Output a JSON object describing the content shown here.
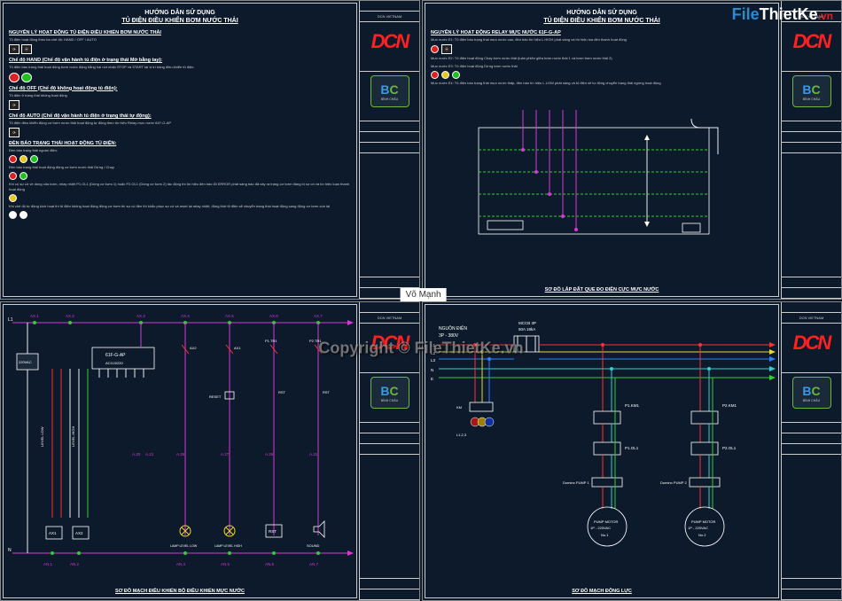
{
  "watermarks": {
    "site_logo_file": "File",
    "site_logo_tk": "ThietKe",
    "site_logo_vn": ".vn",
    "center": "Copyright © FileThietKe.vn",
    "author": "Võ Mạnh"
  },
  "titleblock": {
    "company": "DCN VIETNAM",
    "logo": "DCN",
    "consultant_mark_b": "B",
    "consultant_mark_c": "C",
    "consultant": "BÌNH CHÂU"
  },
  "sheet1": {
    "t1": "HƯỚNG DẪN SỬ DỤNG",
    "t2": "TỦ ĐIỆN ĐIỀU KHIỂN BƠM NƯỚC THẢI",
    "h1": "NGUYÊN LÝ HOẠT ĐỘNG TỦ ĐIỆN ĐIỀU KHIỂN BƠM NƯỚC THẢI",
    "d1": "Tủ điện hoạt động theo ba chế độ: HAND / OFF / AUTO",
    "h2": "Chế độ HAND (Chế độ vận hành tủ điện ở trạng thái Mở bằng tay):",
    "d2": "Tủ điện báo trạng thái hoạt động bơm nước động bằng hai nút nhấn STOP và START tại vị trí bảng điều khiển tủ điện.",
    "h3": "Chế độ OFF (Chế độ không hoạt động tủ điện):",
    "d3": "Tủ điện ở trạng thái không hoạt động",
    "h4": "Chế độ AUTO (Chế độ vận hành tủ điện ở trạng thái tự động):",
    "d4": "Tủ điện điều khiển động cơ bơm nước thải hoạt động tự động theo tín hiệu Relay mực nước 61F-G-AP",
    "h5": "ĐÈN BÁO TRẠNG THÁI HOẠT ĐỘNG TỦ ĐIỆN:",
    "d5a": "Đèn báo trạng thái nguồn điện:",
    "d5b": "Đèn báo trạng thái hoạt động động cơ bơm nước thải Dừng / Chạy",
    "d5c": "Khi có sự cố về dòng của bơm, relay nhiệt P1.OL1 (Dòng cơ bơm 1) hoặc P2.OL1 (Dòng cơ bơm 2) tác động thì tín hiệu đèn báo lỗi ERROR phát sáng báo đã xảy ra trạng cơ bơm đang bị sự cố và tín hiệu loạn thanh hoạt động",
    "d5d": "Khi chế độ tự động kích hoạt thì tủ điện không hoạt động động cơ bơm thì sự cố đèn thì khắc phục sự cố và reset lại relay nhiệt, đồng thời tủ điện sẽ chuyển trạng thái hoạt động sang động cơ bơm còn lại"
  },
  "sheet2": {
    "t1": "HƯỚNG DẪN SỬ DỤNG",
    "t2": "TỦ ĐIỆN ĐIỀU KHIỂN BƠM NƯỚC THẢI",
    "h1": "NGUYÊN LÝ HOẠT ĐỘNG RELAY MỰC NƯỚC 61F-G-AP",
    "d1": "Mực nước E1: Tủ điện báo trạng thái mực nước cao, đèn báo tín hiệu L.HIGH phát sáng và tín hiệu loa đèn thanh hoạt động",
    "d2": "Mực nước E2: Tủ điện hoạt động Chạy bơm nước thải (luân phiên giữa bơm nước thải 1 và bơm bơm nước thải 2)",
    "d3": "Mực nước E3: Tủ điện hoạt động Dừng bơm nước thải",
    "d4": "Mực nước E4: Tủ điện báo trạng thái mực nước thấp, đèn báo tín hiệu L.LOW phát sáng và tủ điện sẽ tự động chuyển trạng thái ngừng hoạt động",
    "caption": "SƠ ĐỒ LẮP ĐẶT QUE ĐO ĐIỆN CỰC MỰC NƯỚC"
  },
  "sheet3": {
    "module": "61F-G-AP",
    "module_v": "AC110/220",
    "vsrc": "220VAC",
    "lbl_low": "LEVEL LOW",
    "lbl_high": "LEVEL HIGH",
    "L1": "L1",
    "N": "N",
    "ax": [
      "AX.1",
      "AX.2",
      "AX.3",
      "AX.4",
      "AX.5",
      "AX.6",
      "AX.7"
    ],
    "a": [
      "A.20",
      "A.21",
      "A.22",
      "A.23",
      "A.24",
      "A.25",
      "A.26",
      "A.27",
      "A.28",
      "A.29",
      "A.30",
      "A.31"
    ],
    "p1tr": "P1.TR1",
    "p2tr": "P2.TR1",
    "reset": "RESET",
    "rst": "RST",
    "ax1": "AX1",
    "ax2": "AX2",
    "lamp_low": "LAMP LEVEL LOW",
    "lamp_high": "LAMP LEVEL HIGH",
    "sound": "SOUND",
    "an": [
      "AN.1",
      "AN.2",
      "AN.3",
      "AN.4",
      "AN.5",
      "AN.6",
      "AN.7"
    ],
    "caption": "SƠ ĐỒ MẠCH ĐIỀU KHIỂN BỘ ĐIỀU KHIỂN MỰC NƯỚC"
  },
  "sheet4": {
    "src": "NGUỒN ĐIỆN",
    "src2": "3P - 380V",
    "breaker": "MCCB 3P",
    "breaker2": "50A 18kA",
    "L1": "L1",
    "L2": "L2",
    "L3": "L3",
    "N": "N",
    "E": "E",
    "km": "KM",
    "l123": "L1,2,3",
    "p1km": "P1.KM1",
    "p2km": "P2.KM1",
    "p1ol": "P1.OL1",
    "p2ol": "P2.OL1",
    "dom1": "Domino PUMP 1",
    "dom2": "Domino PUMP 2",
    "motor_t": "PUMP MOTOR",
    "motor_v": "1P - 220VAC",
    "m1": "No.1",
    "m2": "No.2",
    "caption": "SƠ ĐỒ MẠCH ĐỘNG LỰC"
  }
}
